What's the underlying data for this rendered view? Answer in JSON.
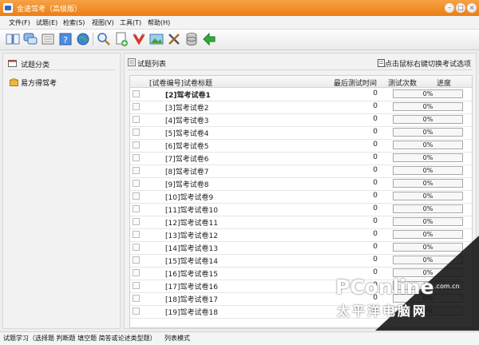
{
  "window": {
    "title": "金途驾考（高级版）"
  },
  "menu": [
    "文件(F)",
    "试题(E)",
    "检索(S)",
    "视图(V)",
    "工具(T)",
    "帮助(H)"
  ],
  "toolbar_icons": [
    "open-book-icon",
    "chat-bubbles-icon",
    "notebook-icon",
    "question-mark-icon",
    "folder-icon",
    "globe-icon",
    "magnifier-icon",
    "new-file-icon",
    "red-magnet-icon",
    "image-icon",
    "tools-icon",
    "database-icon",
    "green-arrow-icon"
  ],
  "left": {
    "header": "试题分类",
    "tree_item": "易方得驾考"
  },
  "right": {
    "title": "试题列表",
    "tip": "点击鼠标右键切换考试选项",
    "columns": [
      "[试卷编号]试卷标题",
      "最后测试时间",
      "测试次数",
      "进度"
    ],
    "rows": [
      {
        "label": "[2]驾考试卷1",
        "count": "0",
        "progress": "0%"
      },
      {
        "label": "[3]驾考试卷2",
        "count": "0",
        "progress": "0%"
      },
      {
        "label": "[4]驾考试卷3",
        "count": "0",
        "progress": "0%"
      },
      {
        "label": "[5]驾考试卷4",
        "count": "0",
        "progress": "0%"
      },
      {
        "label": "[6]驾考试卷5",
        "count": "0",
        "progress": "0%"
      },
      {
        "label": "[7]驾考试卷6",
        "count": "0",
        "progress": "0%"
      },
      {
        "label": "[8]驾考试卷7",
        "count": "0",
        "progress": "0%"
      },
      {
        "label": "[9]驾考试卷8",
        "count": "0",
        "progress": "0%"
      },
      {
        "label": "[10]驾考试卷9",
        "count": "0",
        "progress": "0%"
      },
      {
        "label": "[11]驾考试卷10",
        "count": "0",
        "progress": "0%"
      },
      {
        "label": "[12]驾考试卷11",
        "count": "0",
        "progress": "0%"
      },
      {
        "label": "[13]驾考试卷12",
        "count": "0",
        "progress": "0%"
      },
      {
        "label": "[14]驾考试卷13",
        "count": "0",
        "progress": "0%"
      },
      {
        "label": "[15]驾考试卷14",
        "count": "0",
        "progress": "0%"
      },
      {
        "label": "[16]驾考试卷15",
        "count": "0",
        "progress": "0%"
      },
      {
        "label": "[17]驾考试卷16",
        "count": "0",
        "progress": "0%"
      },
      {
        "label": "[18]驾考试卷17",
        "count": "0",
        "progress": "0%"
      },
      {
        "label": "[19]驾考试卷18",
        "count": "0",
        "progress": "0%"
      }
    ]
  },
  "status": {
    "mode": "试题学习（选择题 判断题 填空题 简答或论述类型题）",
    "view": "列表模式"
  },
  "watermark": {
    "brand": "PConline",
    "domain": ".com.cn",
    "cn": "太平洋电脑网"
  }
}
